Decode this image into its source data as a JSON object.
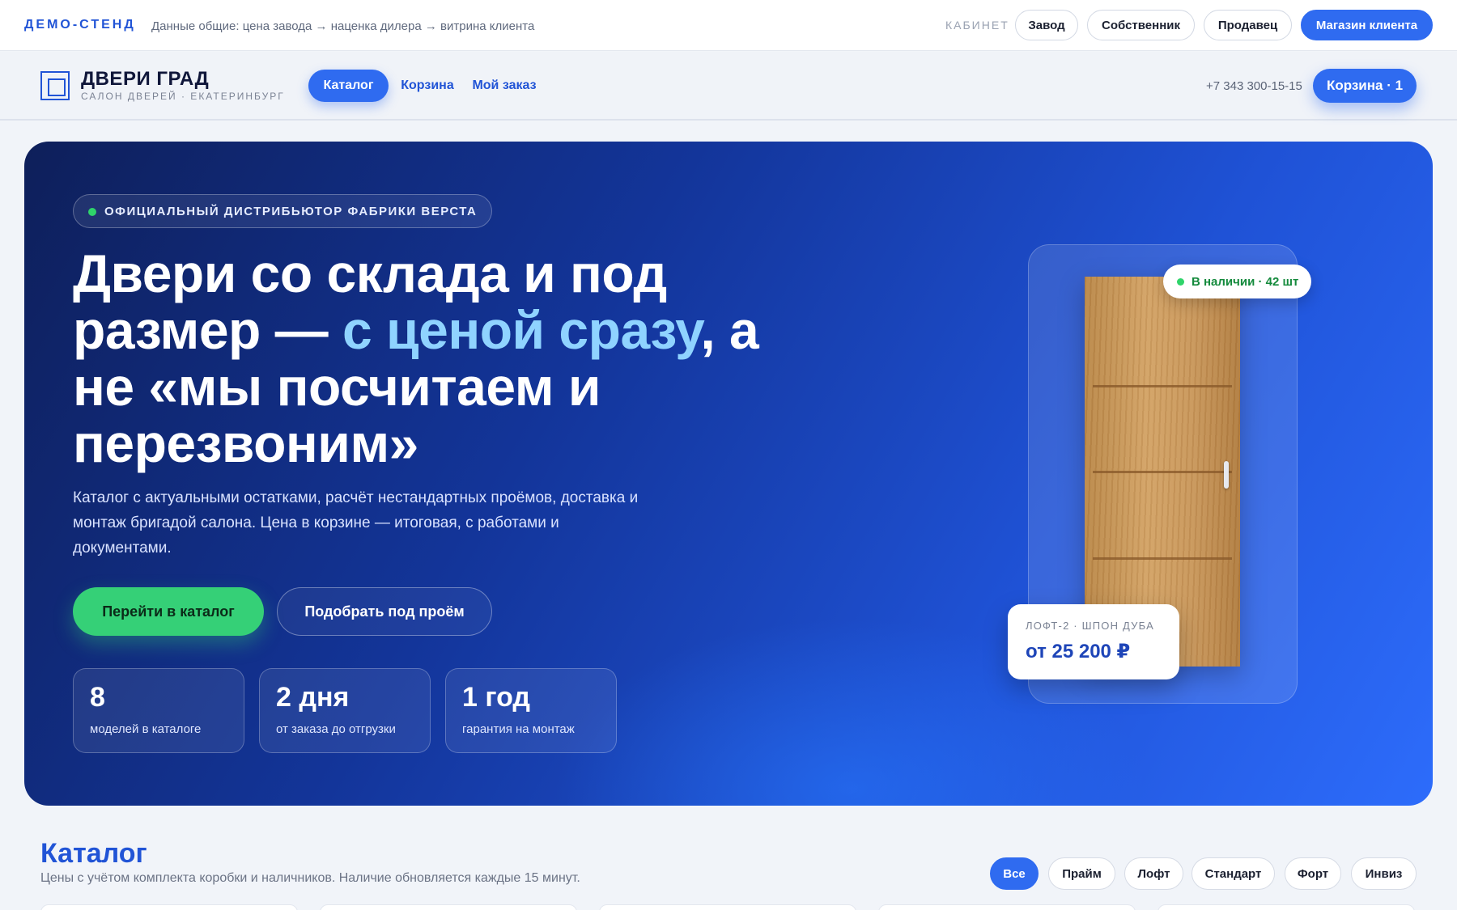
{
  "demo_bar": {
    "brand": "ДЕМО-СТЕНД",
    "note": "Данные общие: цена завода → наценка дилера → витрина клиента",
    "cabinet_label": "КАБИНЕТ",
    "roles": [
      "Завод",
      "Собственник",
      "Продавец",
      "Магазин клиента"
    ],
    "active_role": "Магазин клиента"
  },
  "header": {
    "logo_title": "ДВЕРИ ГРАД",
    "logo_subtitle": "САЛОН ДВЕРЕЙ · ЕКАТЕРИНБУРГ",
    "nav": [
      "Каталог",
      "Корзина",
      "Мой заказ"
    ],
    "active_nav": "Каталог",
    "phone": "+7 343 300-15-15",
    "cart_button": "Корзина · 1"
  },
  "hero": {
    "badge": "ОФИЦИАЛЬНЫЙ ДИСТРИБЬЮТОР ФАБРИКИ  ВЕРСТА",
    "title_part1": "Двери со склада и под размер — ",
    "title_accent": "с ценой сразу",
    "title_part2": ", а не «мы посчитаем и перезвоним»",
    "description": "Каталог с актуальными остатками, расчёт нестандартных проёмов, доставка и монтаж бригадой салона. Цена в корзине — итоговая, с работами и документами.",
    "primary_button": "Перейти в каталог",
    "secondary_button": "Подобрать под проём",
    "stats": [
      {
        "value": "8",
        "label": "моделей в каталоге"
      },
      {
        "value": "2 дня",
        "label": "от заказа до отгрузки"
      },
      {
        "value": "1 год",
        "label": "гарантия на монтаж"
      }
    ],
    "product": {
      "stock": "В наличии · 42 шт",
      "model": "ЛОФТ-2 · ШПОН ДУБА",
      "price": "от 25 200 ₽"
    }
  },
  "catalog": {
    "title": "Каталог",
    "subtitle": "Цены с учётом комплекта коробки и наличников. Наличие обновляется каждые 15 минут.",
    "filters": [
      "Все",
      "Прайм",
      "Лофт",
      "Стандарт",
      "Форт",
      "Инвиз"
    ],
    "active_filter": "Все"
  },
  "colors": {
    "accent": "#2f6bf0",
    "brand": "#2154d6",
    "success": "#35d077",
    "hero_dark": "#0e1f5a"
  }
}
